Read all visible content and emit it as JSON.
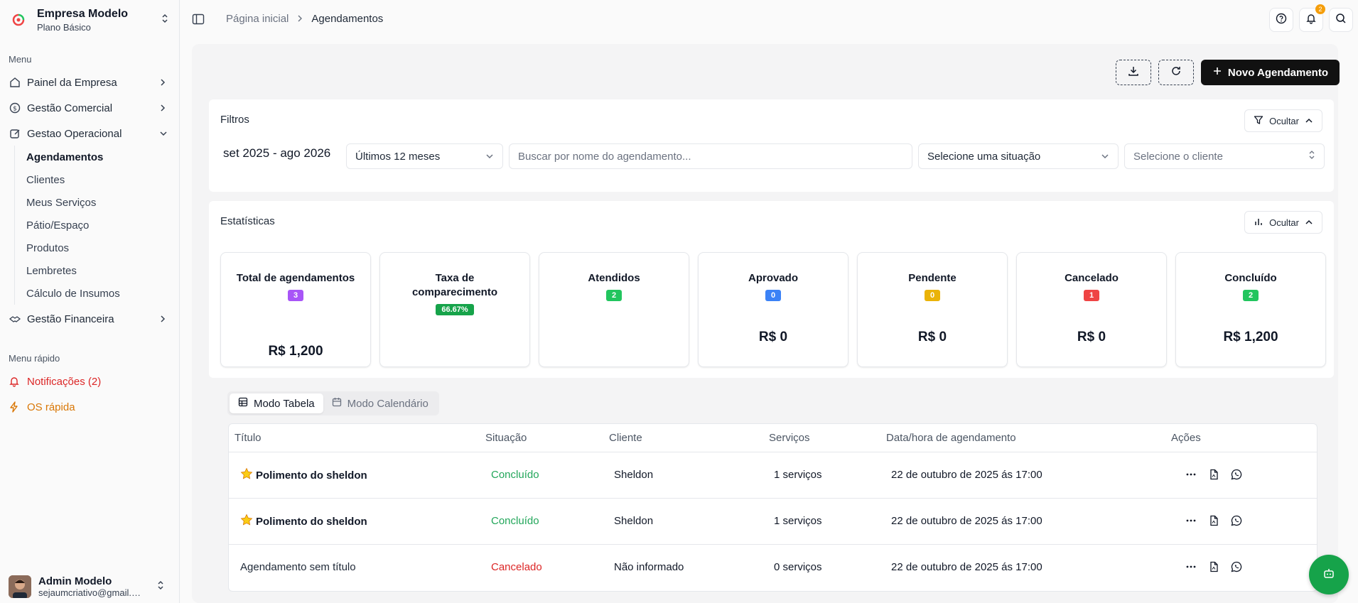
{
  "company": {
    "name": "Empresa Modelo",
    "plan": "Plano Básico"
  },
  "sidebar": {
    "menu_label": "Menu",
    "items": [
      {
        "label": "Painel da Empresa"
      },
      {
        "label": "Gestão Comercial"
      },
      {
        "label": "Gestao Operacional"
      },
      {
        "label": "Gestão Financeira"
      }
    ],
    "sub_items": [
      {
        "label": "Agendamentos"
      },
      {
        "label": "Clientes"
      },
      {
        "label": "Meus Serviços"
      },
      {
        "label": "Pátio/Espaço"
      },
      {
        "label": "Produtos"
      },
      {
        "label": "Lembretes"
      },
      {
        "label": "Cálculo de Insumos"
      }
    ],
    "quick_label": "Menu rápido",
    "quick": [
      {
        "label": "Notificações (2)",
        "color": "#dc2626"
      },
      {
        "label": "OS rápida",
        "color": "#d97706"
      }
    ]
  },
  "user": {
    "name": "Admin Modelo",
    "email": "sejaumcriativo@gmail.com"
  },
  "header": {
    "breadcrumb_home": "Página inicial",
    "breadcrumb_current": "Agendamentos",
    "notification_count": "2"
  },
  "actions": {
    "new_label": "Novo Agendamento"
  },
  "filters": {
    "title": "Filtros",
    "hide_label": "Ocultar",
    "period": "set 2025 - ago 2026",
    "range": "Últimos 12 meses",
    "search_placeholder": "Buscar por nome do agendamento...",
    "status_placeholder": "Selecione uma situação",
    "client_placeholder": "Selecione o cliente"
  },
  "stats": {
    "title": "Estatísticas",
    "hide_label": "Ocultar",
    "cards": [
      {
        "title": "Total de agendamentos",
        "badge": "3",
        "color": "#a855f7",
        "amount": "R$ 1,200"
      },
      {
        "title": "Taxa de comparecimento",
        "badge": "66.67%",
        "color": "#16a34a",
        "amount": ""
      },
      {
        "title": "Atendidos",
        "badge": "2",
        "color": "#22c55e",
        "amount": ""
      },
      {
        "title": "Aprovado",
        "badge": "0",
        "color": "#3b82f6",
        "amount": "R$ 0"
      },
      {
        "title": "Pendente",
        "badge": "0",
        "color": "#eab308",
        "amount": "R$ 0"
      },
      {
        "title": "Cancelado",
        "badge": "1",
        "color": "#ef4444",
        "amount": "R$ 0"
      },
      {
        "title": "Concluído",
        "badge": "2",
        "color": "#22c55e",
        "amount": "R$ 1,200"
      }
    ]
  },
  "tabs": [
    {
      "label": "Modo Tabela"
    },
    {
      "label": "Modo Calendário"
    }
  ],
  "table": {
    "headers": [
      "Título",
      "Situação",
      "Cliente",
      "Serviços",
      "Data/hora de agendamento",
      "Ações"
    ],
    "rows": [
      {
        "title": "Polimento do sheldon",
        "starred": true,
        "status": "Concluído",
        "status_color": "#22a65a",
        "client": "Sheldon",
        "services": "1 serviços",
        "date": "22 de outubro de 2025 ás 17:00"
      },
      {
        "title": "Polimento do sheldon",
        "starred": true,
        "status": "Concluído",
        "status_color": "#22a65a",
        "client": "Sheldon",
        "services": "1 serviços",
        "date": "22 de outubro de 2025 ás 17:00"
      },
      {
        "title": "Agendamento sem título",
        "starred": false,
        "status": "Cancelado",
        "status_color": "#dc2626",
        "client": "Não informado",
        "services": "0 serviços",
        "date": "22 de outubro de 2025 ás 17:00"
      }
    ]
  }
}
